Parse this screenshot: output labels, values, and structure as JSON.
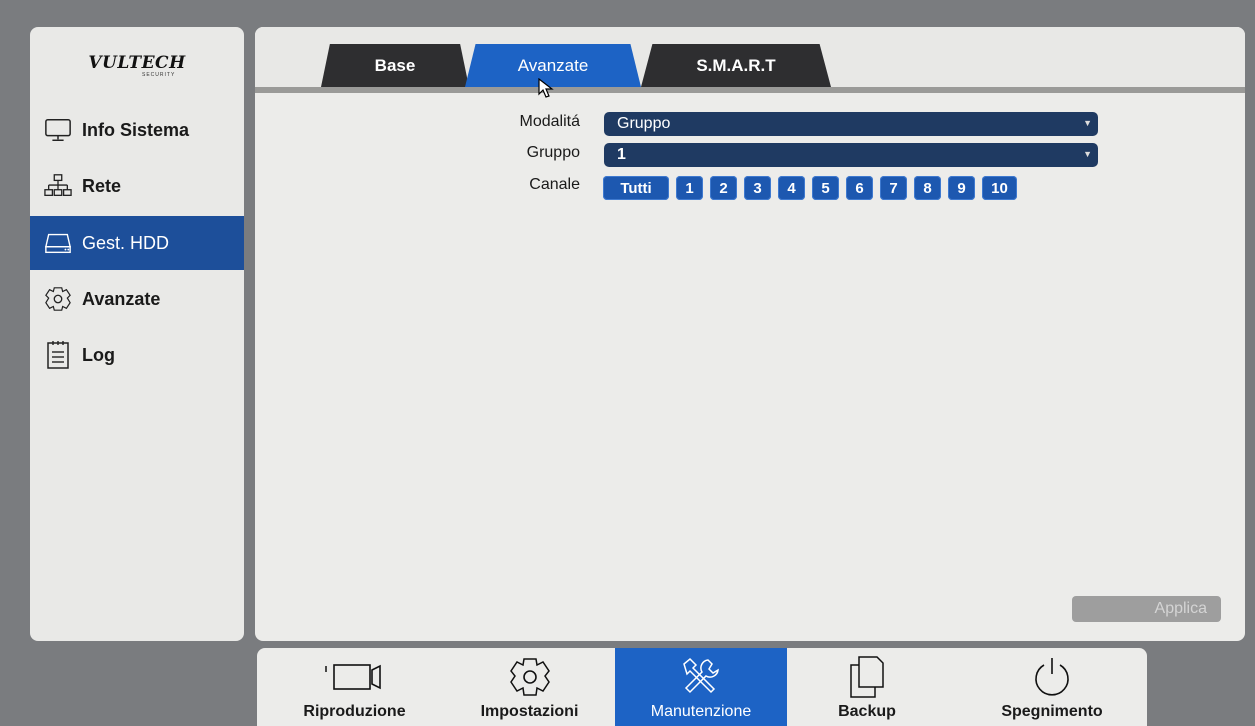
{
  "logo": {
    "brand": "VULTECH",
    "sub": "SECURITY"
  },
  "sidebar": {
    "items": [
      {
        "label": "Info Sistema",
        "icon": "monitor-icon"
      },
      {
        "label": "Rete",
        "icon": "network-icon"
      },
      {
        "label": "Gest. HDD",
        "icon": "hdd-icon",
        "active": true
      },
      {
        "label": "Avanzate",
        "icon": "gear-icon"
      },
      {
        "label": "Log",
        "icon": "log-icon"
      }
    ]
  },
  "tabs": [
    {
      "label": "Base"
    },
    {
      "label": "Avanzate",
      "active": true
    },
    {
      "label": "S.M.A.R.T"
    }
  ],
  "form": {
    "mode_label": "Modalitá",
    "mode_value": "Gruppo",
    "group_label": "Gruppo",
    "group_value": "1",
    "channel_label": "Canale",
    "channels": [
      "Tutti",
      "1",
      "2",
      "3",
      "4",
      "5",
      "6",
      "7",
      "8",
      "9",
      "10"
    ]
  },
  "apply_label": "Applica",
  "bottombar": {
    "items": [
      {
        "label": "Riproduzione",
        "icon": "camera-icon"
      },
      {
        "label": "Impostazioni",
        "icon": "gear-icon"
      },
      {
        "label": "Manutenzione",
        "icon": "tools-icon",
        "active": true
      },
      {
        "label": "Backup",
        "icon": "copy-icon"
      },
      {
        "label": "Spegnimento",
        "icon": "power-icon"
      }
    ]
  },
  "colors": {
    "accent": "#1d63c5",
    "sidebar_active": "#1d4f9a",
    "select_bg": "#1f3a62",
    "tab_dark": "#2e2e30"
  }
}
